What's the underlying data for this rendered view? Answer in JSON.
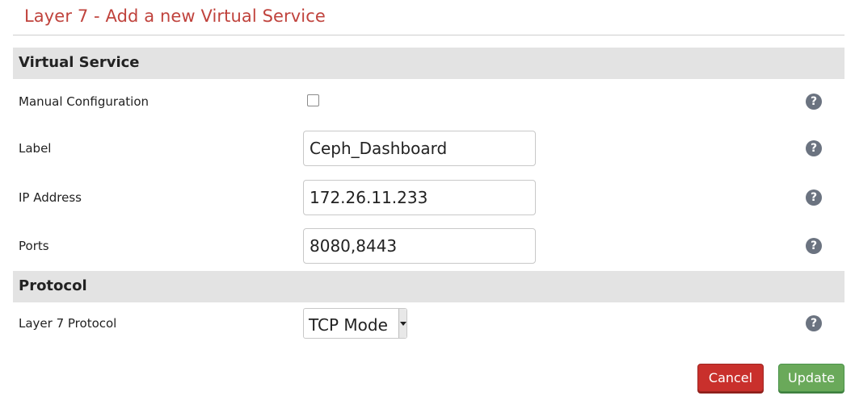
{
  "page_title": "Layer 7 - Add a new Virtual Service",
  "sections": {
    "virtual_service": "Virtual Service",
    "protocol": "Protocol"
  },
  "fields": {
    "manual_configuration": {
      "label": "Manual Configuration",
      "checked": false
    },
    "label": {
      "label": "Label",
      "value": "Ceph_Dashboard"
    },
    "ip_address": {
      "label": "IP Address",
      "value": "172.26.11.233"
    },
    "ports": {
      "label": "Ports",
      "value": "8080,8443"
    },
    "layer7_protocol": {
      "label": "Layer 7 Protocol",
      "value": "TCP Mode"
    }
  },
  "help_glyph": "?",
  "buttons": {
    "cancel": "Cancel",
    "update": "Update"
  },
  "colors": {
    "title": "#c0433d",
    "section_bg": "#e3e3e3",
    "cancel": "#c9302c",
    "update": "#6aa95a",
    "help_icon": "#6b7380"
  },
  "icons": {
    "help": "help-question-icon",
    "dropdown": "chevron-down-icon"
  }
}
